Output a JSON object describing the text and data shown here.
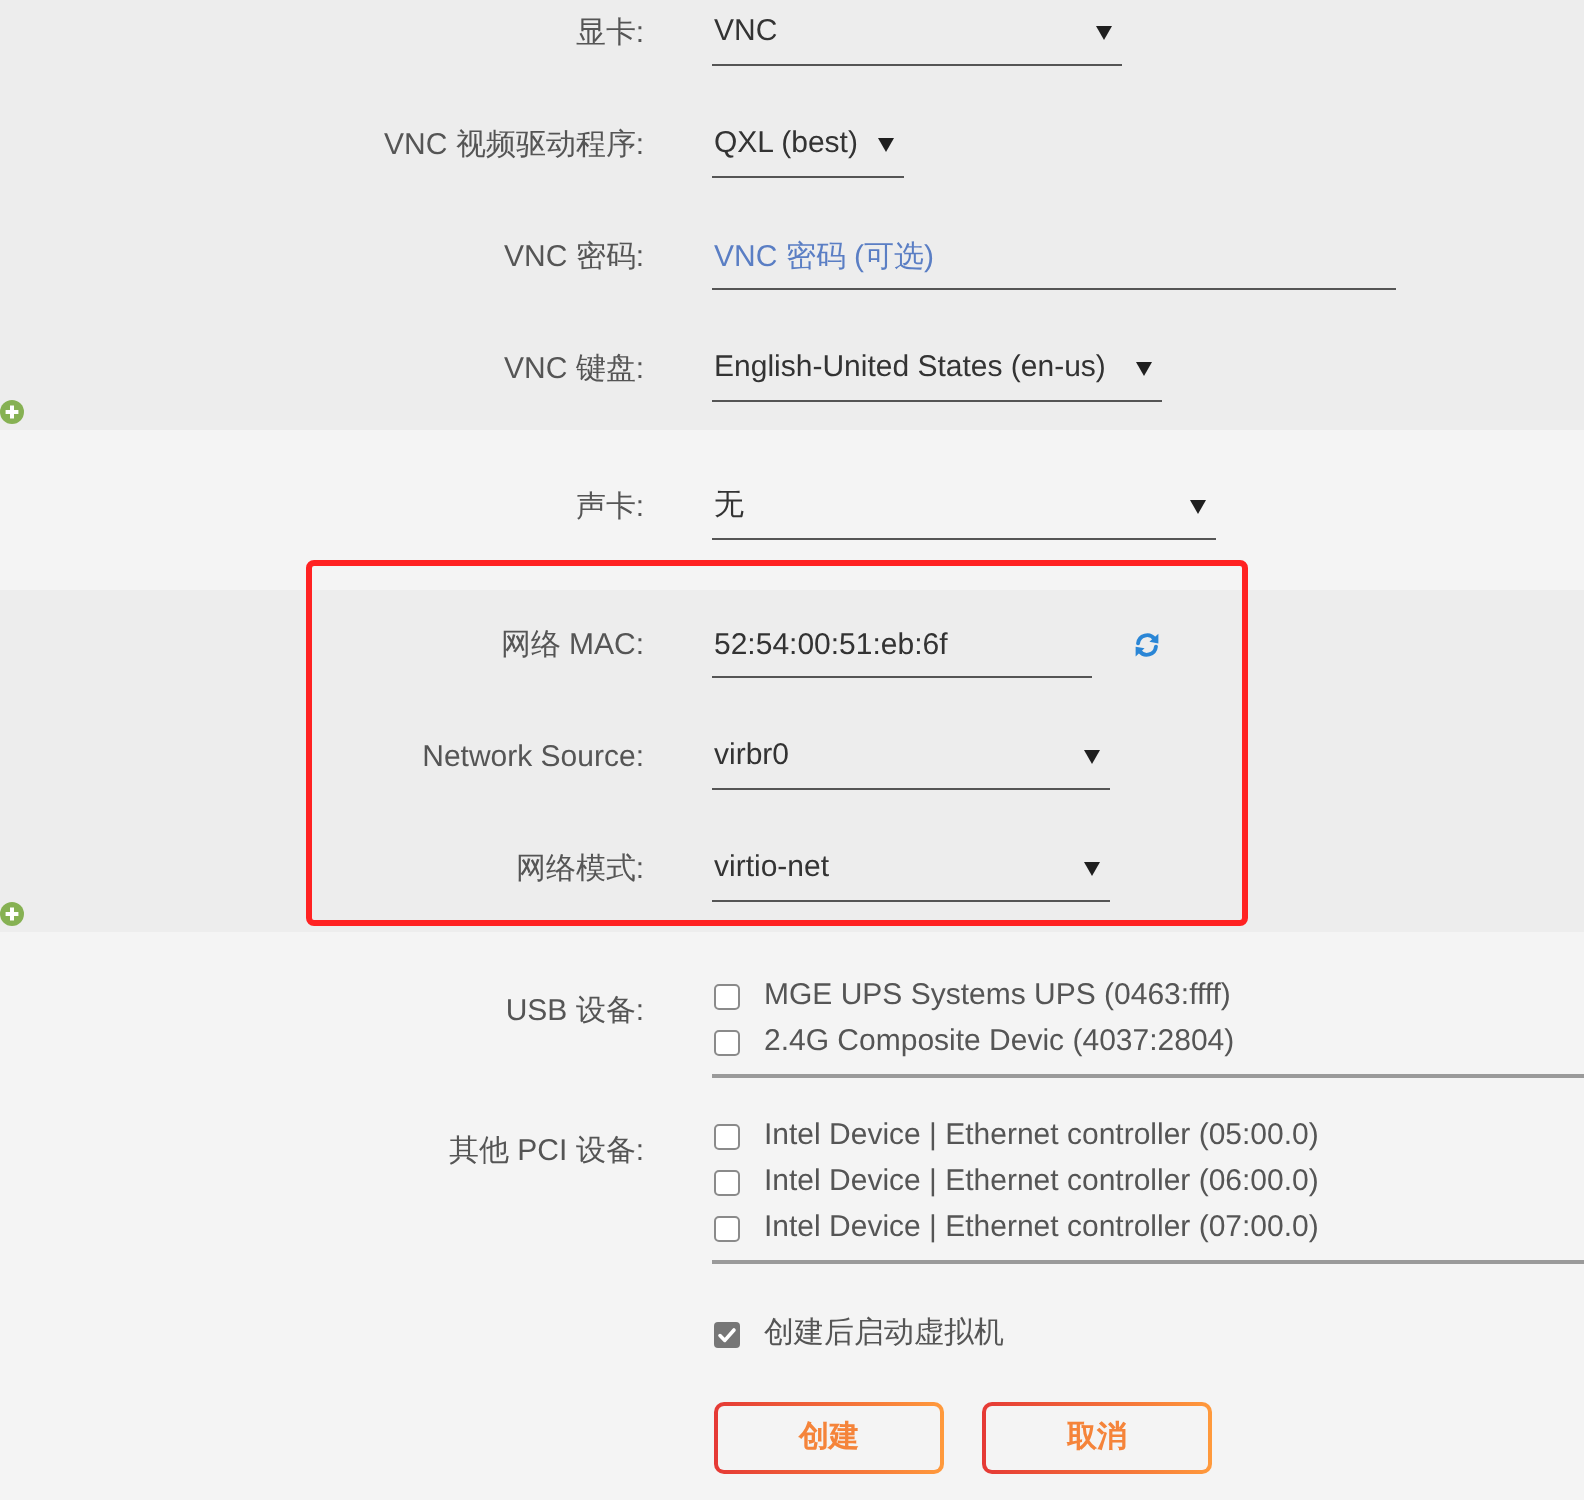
{
  "sections": [
    {
      "addable": true,
      "highlighted": false,
      "rows": [
        {
          "kind": "select",
          "label": "显卡:",
          "value": "VNC"
        },
        {
          "kind": "select",
          "label": "VNC 视频驱动程序:",
          "value": "QXL (best)"
        },
        {
          "kind": "input",
          "label": "VNC 密码:",
          "placeholder": "VNC 密码 (可选)"
        },
        {
          "kind": "select",
          "label": "VNC 键盘:",
          "value": "English-United States (en-us)"
        }
      ]
    },
    {
      "addable": false,
      "highlighted": false,
      "rows": [
        {
          "kind": "select",
          "label": "声卡:",
          "value": "无"
        }
      ]
    },
    {
      "addable": true,
      "highlighted": true,
      "rows": [
        {
          "kind": "input",
          "label": "网络 MAC:",
          "value": "52:54:00:51:eb:6f",
          "refresh_button": true
        },
        {
          "kind": "select",
          "label": "Network Source:",
          "value": "virbr0"
        },
        {
          "kind": "select",
          "label": "网络模式:",
          "value": "virtio-net"
        }
      ]
    },
    {
      "addable": false,
      "highlighted": false,
      "rows": [
        {
          "kind": "checklist",
          "label": "USB 设备:",
          "items": [
            {
              "label": "MGE UPS Systems UPS (0463:ffff)",
              "checked": false
            },
            {
              "label": "2.4G Composite Devic (4037:2804)",
              "checked": false
            }
          ]
        },
        {
          "kind": "checklist",
          "label": "其他 PCI 设备:",
          "items": [
            {
              "label": "Intel Device | Ethernet controller (05:00.0)",
              "checked": false
            },
            {
              "label": "Intel Device | Ethernet controller (06:00.0)",
              "checked": false
            },
            {
              "label": "Intel Device | Ethernet controller (07:00.0)",
              "checked": false
            }
          ]
        },
        {
          "kind": "checkbox",
          "label": "创建后启动虚拟机",
          "checked": true
        }
      ]
    }
  ],
  "buttons": [
    {
      "label": "创建"
    },
    {
      "label": "取消"
    }
  ]
}
